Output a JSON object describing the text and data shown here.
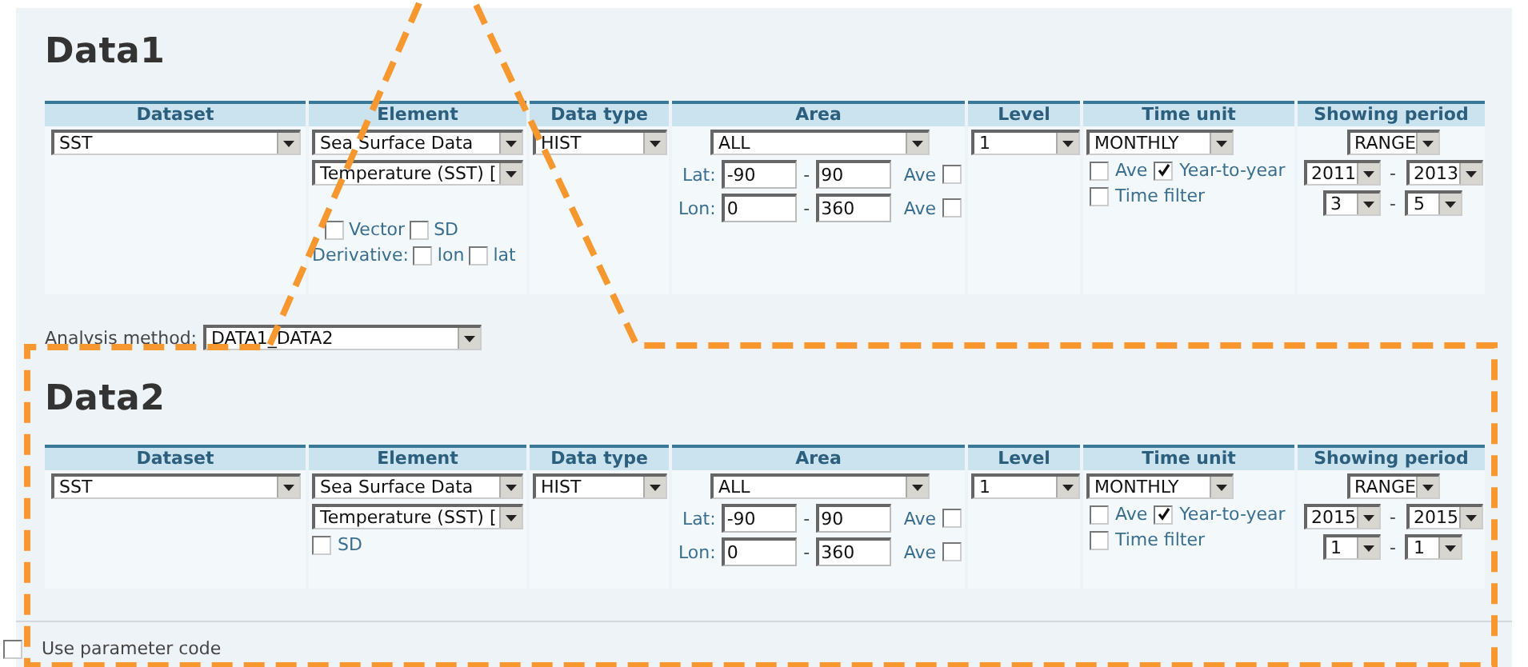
{
  "sections": [
    {
      "title": "Data1",
      "columns": [
        "Dataset",
        "Element",
        "Data type",
        "Area",
        "Level",
        "Time unit",
        "Showing period"
      ],
      "dataset": "SST",
      "element": "Sea Surface Data",
      "element_detail": "Temperature (SST) [",
      "element_checks": [
        {
          "label": "Vector",
          "checked": false
        },
        {
          "label": "SD",
          "checked": false
        }
      ],
      "derivative": {
        "label": "Derivative:",
        "checks": [
          {
            "label": "lon",
            "checked": false
          },
          {
            "label": "lat",
            "checked": false
          }
        ]
      },
      "data_type": "HIST",
      "area": {
        "region": "ALL",
        "rows": [
          {
            "label": "Lat:",
            "from": "-90",
            "separator": "-",
            "to": "90",
            "ave_label": "Ave",
            "ave_checked": false
          },
          {
            "label": "Lon:",
            "from": "0",
            "separator": "-",
            "to": "360",
            "ave_label": "Ave",
            "ave_checked": false
          }
        ]
      },
      "level": "1",
      "time_unit": {
        "value": "MONTHLY",
        "checks": [
          {
            "label": "Ave",
            "checked": false
          },
          {
            "label": "Year-to-year",
            "checked": true
          }
        ],
        "filter": {
          "label": "Time filter",
          "checked": false
        }
      },
      "period": {
        "mode": "RANGE",
        "years": {
          "from": "2011",
          "separator": "-",
          "to": "2013"
        },
        "months": {
          "from": "3",
          "separator": "-",
          "to": "5"
        }
      }
    },
    {
      "title": "Data2",
      "columns": [
        "Dataset",
        "Element",
        "Data type",
        "Area",
        "Level",
        "Time unit",
        "Showing period"
      ],
      "dataset": "SST",
      "element": "Sea Surface Data",
      "element_detail": "Temperature (SST) [",
      "element_checks": [
        {
          "label": "SD",
          "checked": false
        }
      ],
      "data_type": "HIST",
      "area": {
        "region": "ALL",
        "rows": [
          {
            "label": "Lat:",
            "from": "-90",
            "separator": "-",
            "to": "90",
            "ave_label": "Ave",
            "ave_checked": false
          },
          {
            "label": "Lon:",
            "from": "0",
            "separator": "-",
            "to": "360",
            "ave_label": "Ave",
            "ave_checked": false
          }
        ]
      },
      "level": "1",
      "time_unit": {
        "value": "MONTHLY",
        "checks": [
          {
            "label": "Ave",
            "checked": false
          },
          {
            "label": "Year-to-year",
            "checked": true
          }
        ],
        "filter": {
          "label": "Time filter",
          "checked": false
        }
      },
      "period": {
        "mode": "RANGE",
        "years": {
          "from": "2015",
          "separator": "-",
          "to": "2015"
        },
        "months": {
          "from": "1",
          "separator": "-",
          "to": "1"
        }
      }
    }
  ],
  "analysis_method": {
    "label": "Analysis method:",
    "value": "DATA1_DATA2"
  },
  "use_parameter_code": {
    "label": "Use parameter code",
    "checked": false
  }
}
